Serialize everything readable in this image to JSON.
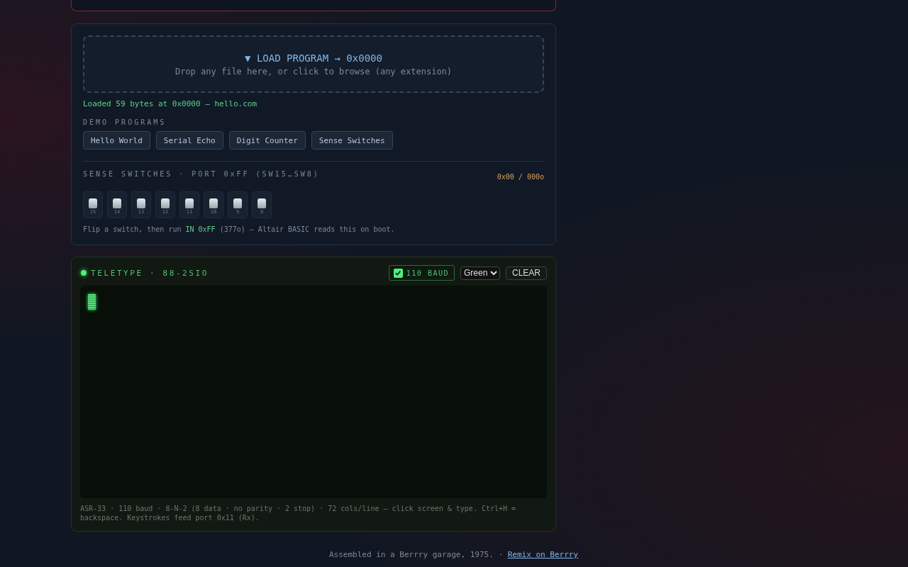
{
  "loader": {
    "title": "▼ LOAD PROGRAM → 0x0000",
    "hint": "Drop any file here, or click to browse (any extension)",
    "status": "Loaded 59 bytes at 0x0000 — hello.com"
  },
  "demos": {
    "label": "DEMO PROGRAMS",
    "buttons": [
      "Hello World",
      "Serial Echo",
      "Digit Counter",
      "Sense Switches"
    ]
  },
  "switches": {
    "label": "SENSE SWITCHES · PORT 0xFF (SW15…SW8)",
    "value": "0x00 / 000o",
    "items": [
      {
        "label": "15",
        "on": false
      },
      {
        "label": "14",
        "on": false
      },
      {
        "label": "13",
        "on": false
      },
      {
        "label": "12",
        "on": false
      },
      {
        "label": "11",
        "on": false
      },
      {
        "label": "10",
        "on": false
      },
      {
        "label": "9",
        "on": false
      },
      {
        "label": "8",
        "on": false
      }
    ],
    "note": "Flip a switch, then run **IN 0xFF** (377o) — Altair BASIC reads this on boot."
  },
  "teletype": {
    "title": "TELETYPE · 88-2SIO",
    "powered": true,
    "baud": {
      "label": "110 BAUD",
      "checked": true
    },
    "theme": "Green",
    "clear": "CLEAR",
    "info": "ASR-33 · 110 baud · 8-N-2 (8 data · no parity · 2 stop) · 72 cols/line — click screen & type. Ctrl+H = backspace. Keystrokes feed port 0x11 (Rx)."
  },
  "footer": {
    "text": "Assembled in a Berrry garage, 1975. · ",
    "link": "Remix on Berrry"
  }
}
